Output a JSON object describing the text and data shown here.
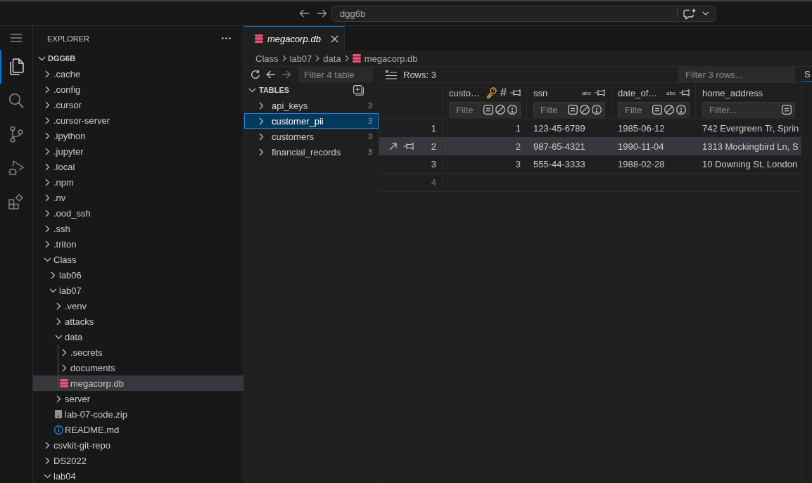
{
  "title_bar": {
    "search_text": "dgg6b"
  },
  "activity_bar": [
    {
      "kind": "menu",
      "selected": false
    },
    {
      "kind": "explorer",
      "selected": true
    },
    {
      "kind": "search",
      "selected": false
    },
    {
      "kind": "source_control",
      "selected": false
    },
    {
      "kind": "run_debug",
      "selected": false
    },
    {
      "kind": "extensions",
      "selected": false
    }
  ],
  "sidebar": {
    "title": "EXPLORER",
    "root": {
      "label": "DGG6B",
      "kind": "folder",
      "expanded": true,
      "selected": false,
      "children": [
        {
          "label": ".cache",
          "kind": "folder",
          "expanded": false,
          "selected": false
        },
        {
          "label": ".config",
          "kind": "folder",
          "expanded": false,
          "selected": false
        },
        {
          "label": ".cursor",
          "kind": "folder",
          "expanded": false,
          "selected": false
        },
        {
          "label": ".cursor-server",
          "kind": "folder",
          "expanded": false,
          "selected": false
        },
        {
          "label": ".ipython",
          "kind": "folder",
          "expanded": false,
          "selected": false
        },
        {
          "label": ".jupyter",
          "kind": "folder",
          "expanded": false,
          "selected": false
        },
        {
          "label": ".local",
          "kind": "folder",
          "expanded": false,
          "selected": false
        },
        {
          "label": ".npm",
          "kind": "folder",
          "expanded": false,
          "selected": false
        },
        {
          "label": ".nv",
          "kind": "folder",
          "expanded": false,
          "selected": false
        },
        {
          "label": ".ood_ssh",
          "kind": "folder",
          "expanded": false,
          "selected": false
        },
        {
          "label": ".ssh",
          "kind": "folder",
          "expanded": false,
          "selected": false
        },
        {
          "label": ".triton",
          "kind": "folder",
          "expanded": false,
          "selected": false
        },
        {
          "label": "Class",
          "kind": "folder",
          "expanded": true,
          "selected": false,
          "children": [
            {
              "label": "lab06",
              "kind": "folder",
              "expanded": false,
              "selected": false
            },
            {
              "label": "lab07",
              "kind": "folder",
              "expanded": true,
              "selected": false,
              "children": [
                {
                  "label": ".venv",
                  "kind": "folder",
                  "expanded": false,
                  "selected": false
                },
                {
                  "label": "attacks",
                  "kind": "folder",
                  "expanded": false,
                  "selected": false
                },
                {
                  "label": "data",
                  "kind": "folder",
                  "expanded": true,
                  "selected": false,
                  "children": [
                    {
                      "label": ".secrets",
                      "kind": "folder",
                      "expanded": false,
                      "selected": false
                    },
                    {
                      "label": "documents",
                      "kind": "folder",
                      "expanded": false,
                      "selected": false
                    },
                    {
                      "label": "megacorp.db",
                      "kind": "database",
                      "selected": true
                    }
                  ]
                },
                {
                  "label": "server",
                  "kind": "folder",
                  "expanded": false,
                  "selected": false
                },
                {
                  "label": "lab-07-code.zip",
                  "kind": "archive",
                  "selected": false
                },
                {
                  "label": "README.md",
                  "kind": "info",
                  "selected": false
                }
              ]
            }
          ]
        },
        {
          "label": "csvkit-git-repo",
          "kind": "folder",
          "expanded": false,
          "selected": false
        },
        {
          "label": "DS2022",
          "kind": "folder",
          "expanded": false,
          "selected": false
        },
        {
          "label": "lab04",
          "kind": "folder",
          "expanded": true,
          "selected": false
        }
      ]
    }
  },
  "editor": {
    "tabs": [
      {
        "label": "megacorp.db",
        "kind": "database",
        "selected": true
      }
    ],
    "breadcrumb": [
      {
        "label": "Class",
        "kind": "folder"
      },
      {
        "label": "lab07",
        "kind": "folder"
      },
      {
        "label": "data",
        "kind": "folder"
      },
      {
        "label": "megacorp.db",
        "kind": "database"
      }
    ],
    "tables_pane": {
      "filter_placeholder": "Filter 4 table",
      "section": {
        "label": "TABLES",
        "expanded": true
      },
      "tables": [
        {
          "name": "api_keys",
          "count": "3",
          "selected": false
        },
        {
          "name": "customer_pii",
          "count": "3",
          "selected": true
        },
        {
          "name": "customers",
          "count": "3",
          "selected": false
        },
        {
          "name": "financial_records",
          "count": "3",
          "selected": false
        }
      ]
    },
    "grid": {
      "rows_label": "Rows: 3",
      "filter_placeholder": "Filter 3 rows...",
      "columns": [
        {
          "name": "custo…",
          "kind": "integer",
          "primary_key": true,
          "type_mark": "#",
          "pin_button": true,
          "filter_placeholder": "Filte",
          "filter_modes": [
            {
              "kind": "exact"
            },
            {
              "kind": "null"
            },
            {
              "kind": "error"
            }
          ]
        },
        {
          "name": "ssn",
          "kind": "text",
          "primary_key": false,
          "type_mark": "abc",
          "pin_button": true,
          "filter_placeholder": "Filte",
          "filter_modes": [
            {
              "kind": "exact"
            },
            {
              "kind": "null"
            },
            {
              "kind": "error"
            }
          ]
        },
        {
          "name": "date_of…",
          "kind": "text",
          "primary_key": false,
          "type_mark": "abc",
          "pin_button": true,
          "filter_placeholder": "Filte",
          "filter_modes": [
            {
              "kind": "exact"
            },
            {
              "kind": "null"
            },
            {
              "kind": "error"
            }
          ]
        },
        {
          "name": "home_address",
          "kind": "text",
          "primary_key": false,
          "pin_button": false,
          "filter_placeholder": "Filter...",
          "filter_modes": [
            {
              "kind": "exact"
            }
          ]
        }
      ],
      "rows": [
        {
          "number": "1",
          "selected": false,
          "cells": [
            "1",
            "123-45-6789",
            "1985-06-12",
            "742 Evergreen Tr, Sprin"
          ]
        },
        {
          "number": "2",
          "selected": true,
          "cells": [
            "2",
            "987-65-4321",
            "1990-11-04",
            "1313 Mockingbird Ln, S"
          ]
        },
        {
          "number": "3",
          "selected": false,
          "cells": [
            "3",
            "555-44-3333",
            "1988-02-28",
            "10 Downing St, London"
          ]
        }
      ],
      "new_row": {
        "number": "4"
      }
    },
    "side_panel": {
      "tab_label": "S",
      "selected": true
    }
  }
}
